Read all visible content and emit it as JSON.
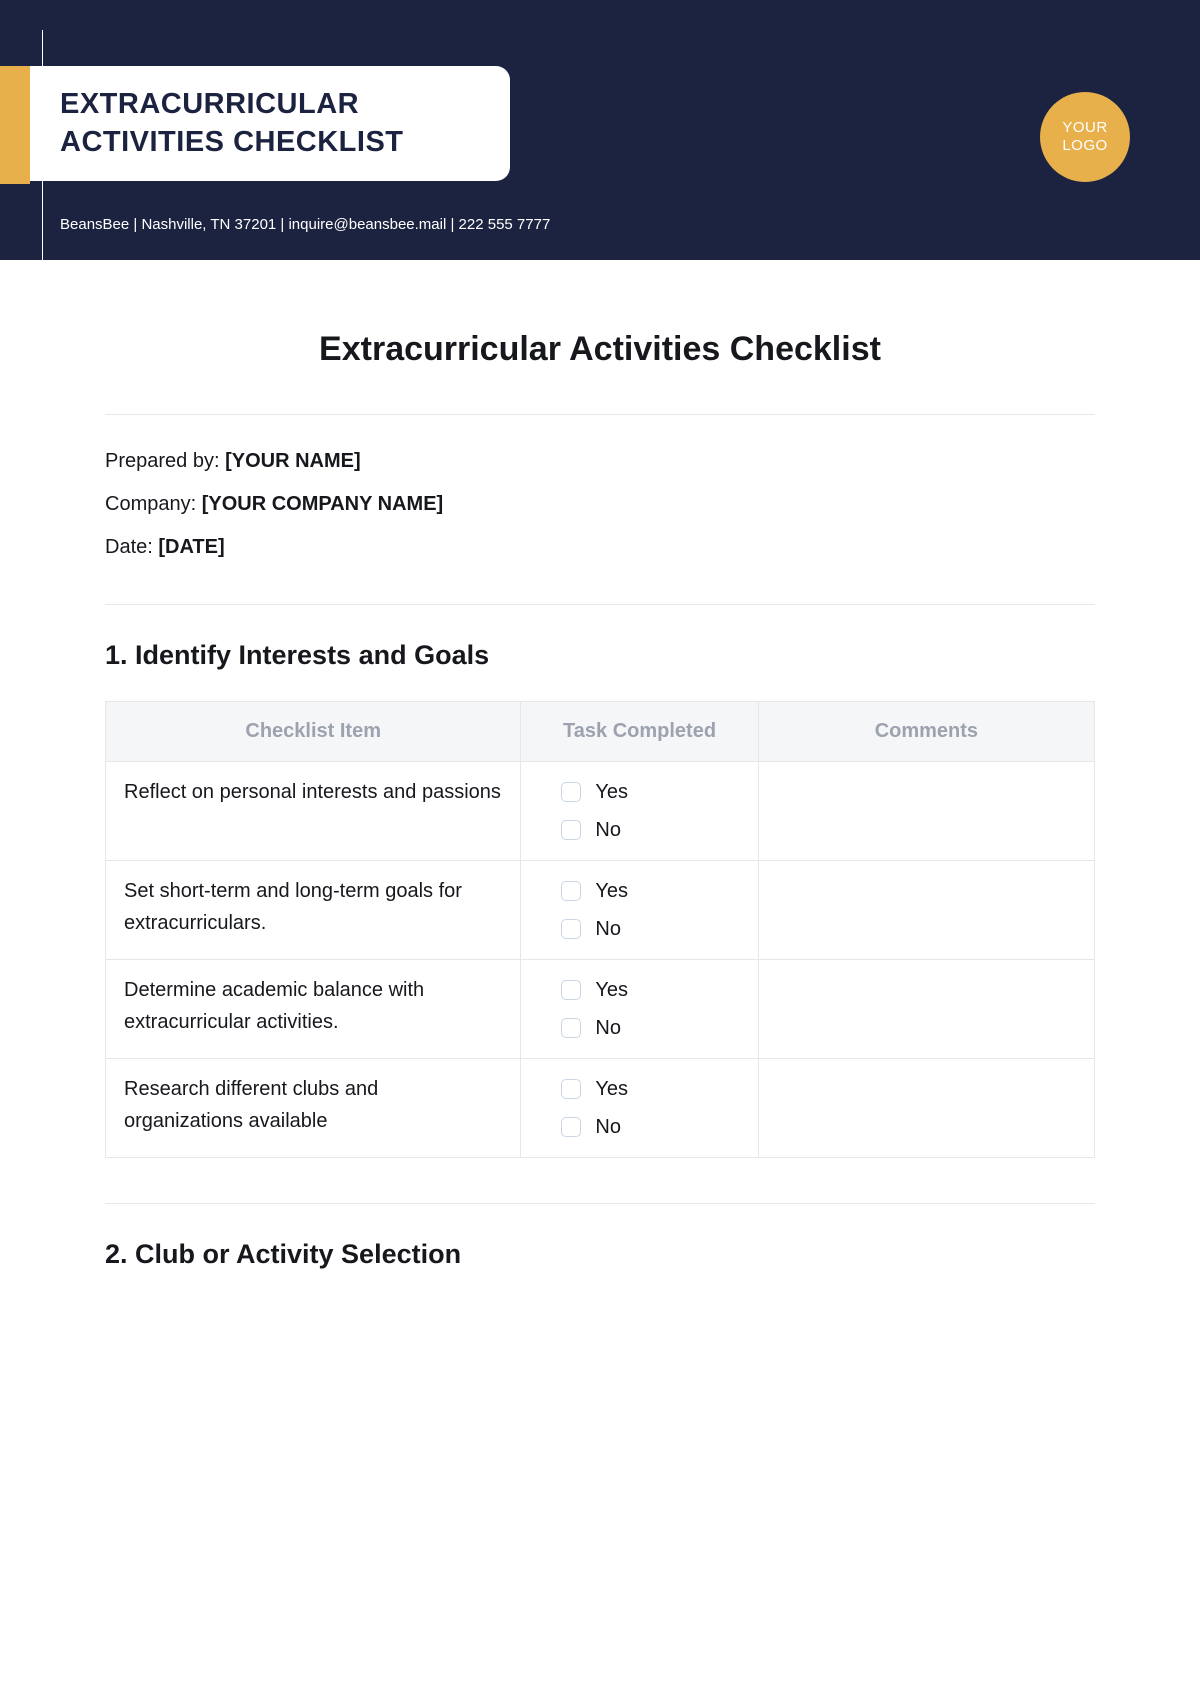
{
  "header": {
    "title_line1": "EXTRACURRICULAR",
    "title_line2": "ACTIVITIES CHECKLIST",
    "contact": "BeansBee | Nashville, TN 37201 | inquire@beansbee.mail | 222 555 7777",
    "logo_line1": "YOUR",
    "logo_line2": "LOGO"
  },
  "content": {
    "main_title": "Extracurricular Activities Checklist",
    "meta": {
      "prepared_by_label": "Prepared by: ",
      "prepared_by_value": "[YOUR NAME]",
      "company_label": "Company: ",
      "company_value": "[YOUR COMPANY NAME]",
      "date_label": "Date: ",
      "date_value": "[DATE]"
    },
    "section1": {
      "title": "1. Identify Interests and Goals",
      "headers": {
        "col1": "Checklist Item",
        "col2": "Task Completed",
        "col3": "Comments"
      },
      "yes_label": "Yes",
      "no_label": "No",
      "rows": [
        {
          "item": "Reflect on personal interests and passions",
          "comments": ""
        },
        {
          "item": "Set short-term and long-term goals for extracurriculars.",
          "comments": ""
        },
        {
          "item": "Determine academic balance with extracurricular activities.",
          "comments": ""
        },
        {
          "item": "Research different clubs and organizations available",
          "comments": ""
        }
      ]
    },
    "section2": {
      "title": "2. Club or Activity Selection"
    }
  }
}
